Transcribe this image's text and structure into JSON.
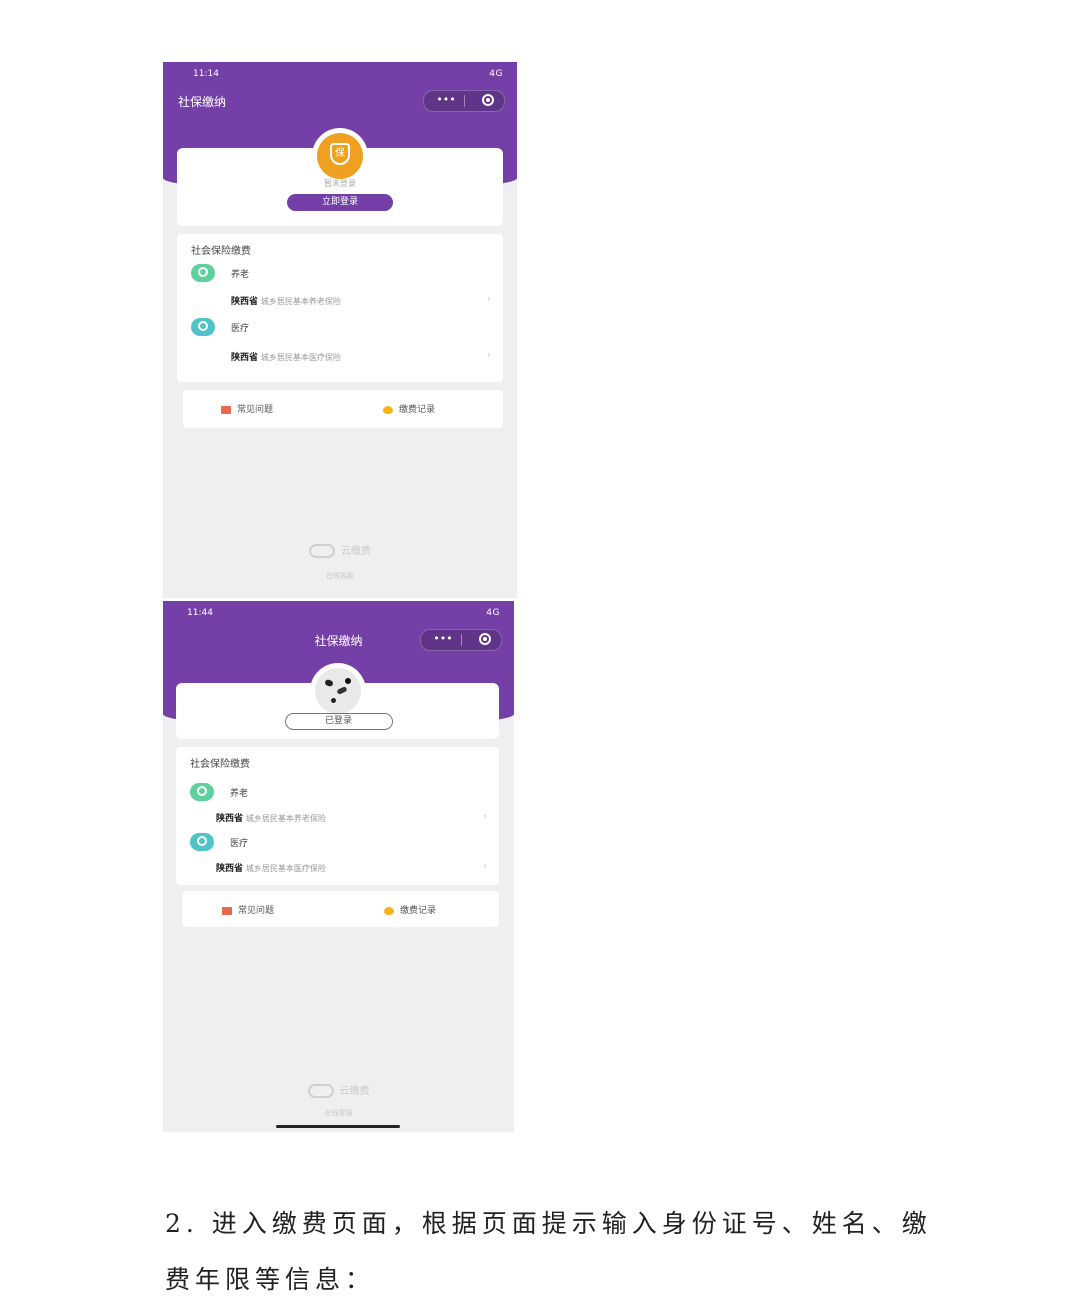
{
  "screen1": {
    "status_time": "11:14",
    "status_signal": "4G",
    "title": "社保缴纳",
    "avatar_glyph": "保",
    "login_hint": "暂未登录",
    "login_button": "立即登录",
    "section_title": "社会保险缴费",
    "items": [
      {
        "type": "养老",
        "province": "陕西省",
        "plan": "城乡居民基本养老保险"
      },
      {
        "type": "医疗",
        "province": "陕西省",
        "plan": "城乡居民基本医疗保险"
      }
    ],
    "link_faq": "常见问题",
    "link_records": "缴费记录",
    "brand": "云缴费",
    "service": "在线客服"
  },
  "screen2": {
    "status_time": "11:44",
    "status_signal": "4G",
    "title": "社保缴纳",
    "login_button": "已登录",
    "section_title": "社会保险缴费",
    "items": [
      {
        "type": "养老",
        "province": "陕西省",
        "plan": "城乡居民基本养老保险"
      },
      {
        "type": "医疗",
        "province": "陕西省",
        "plan": "城乡居民基本医疗保险"
      }
    ],
    "link_faq": "常见问题",
    "link_records": "缴费记录",
    "brand": "云缴费",
    "service": "在线客服"
  },
  "capsule": {
    "dots": "•••"
  },
  "chevron": "›",
  "caption": {
    "line1": "2. 进入缴费页面，根据页面提示输入身份证号、姓名、缴",
    "line2": "费年限等信息："
  },
  "colors": {
    "brand_purple": "#7440a8",
    "avatar_orange": "#f0a020",
    "leaf_green": "#5fcf9e",
    "medical_teal": "#4fc3c8"
  }
}
